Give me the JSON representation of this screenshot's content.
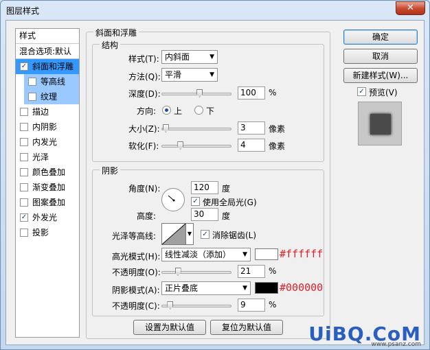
{
  "window": {
    "title": "图层样式",
    "close": "✕"
  },
  "style_list": {
    "header": "样式",
    "blend_label": "混合选项:默认",
    "items": [
      {
        "label": "斜面和浮雕",
        "checked": true
      },
      {
        "label": "等高线",
        "checked": false
      },
      {
        "label": "纹理",
        "checked": false
      },
      {
        "label": "描边",
        "checked": false
      },
      {
        "label": "内阴影",
        "checked": false
      },
      {
        "label": "内发光",
        "checked": false
      },
      {
        "label": "光泽",
        "checked": false
      },
      {
        "label": "颜色叠加",
        "checked": false
      },
      {
        "label": "渐变叠加",
        "checked": false
      },
      {
        "label": "图案叠加",
        "checked": false
      },
      {
        "label": "外发光",
        "checked": true
      },
      {
        "label": "投影",
        "checked": false
      }
    ]
  },
  "bevel": {
    "title": "斜面和浮雕",
    "structure": {
      "title": "结构",
      "style_label": "样式(T):",
      "style_value": "内斜面",
      "method_label": "方法(Q):",
      "method_value": "平滑",
      "depth_label": "深度(D):",
      "depth_value": "100",
      "depth_unit": "%",
      "depth_pos": 0.55,
      "direction_label": "方向:",
      "dir_up": "上",
      "dir_down": "下",
      "size_label": "大小(Z):",
      "size_value": "3",
      "size_unit": "像素",
      "size_pos": 0.02,
      "soften_label": "软化(F):",
      "soften_value": "4",
      "soften_unit": "像素",
      "soften_pos": 0.25
    },
    "shading": {
      "title": "阴影",
      "angle_label": "角度(N):",
      "angle_value": "120",
      "angle_unit": "度",
      "global_light": "使用全局光(G)",
      "altitude_label": "高度:",
      "altitude_value": "30",
      "altitude_unit": "度",
      "gloss_label": "光泽等高线:",
      "antialias": "消除锯齿(L)",
      "highlight_label": "高光模式(H):",
      "highlight_value": "线性减淡（添加）",
      "highlight_color": "#ffffff",
      "highlight_hex": "#ffffff",
      "hl_opacity_label": "不透明度(O):",
      "hl_opacity_value": "21",
      "hl_opacity_unit": "%",
      "hl_opacity_pos": 0.21,
      "shadow_label": "阴影模式(A):",
      "shadow_value": "正片叠底",
      "shadow_color": "#000000",
      "shadow_hex": "#000000",
      "sh_opacity_label": "不透明度(C):",
      "sh_opacity_value": "9",
      "sh_opacity_unit": "%",
      "sh_opacity_pos": 0.09
    },
    "set_default": "设置为默认值",
    "reset_default": "复位为默认值"
  },
  "buttons": {
    "ok": "确定",
    "cancel": "取消",
    "new_style": "新建样式(W)...",
    "preview": "预览(V)"
  },
  "watermark": {
    "main": "UiBQ.CoM",
    "sub": "www.psanz.com"
  },
  "hex_color": "#e0202a"
}
